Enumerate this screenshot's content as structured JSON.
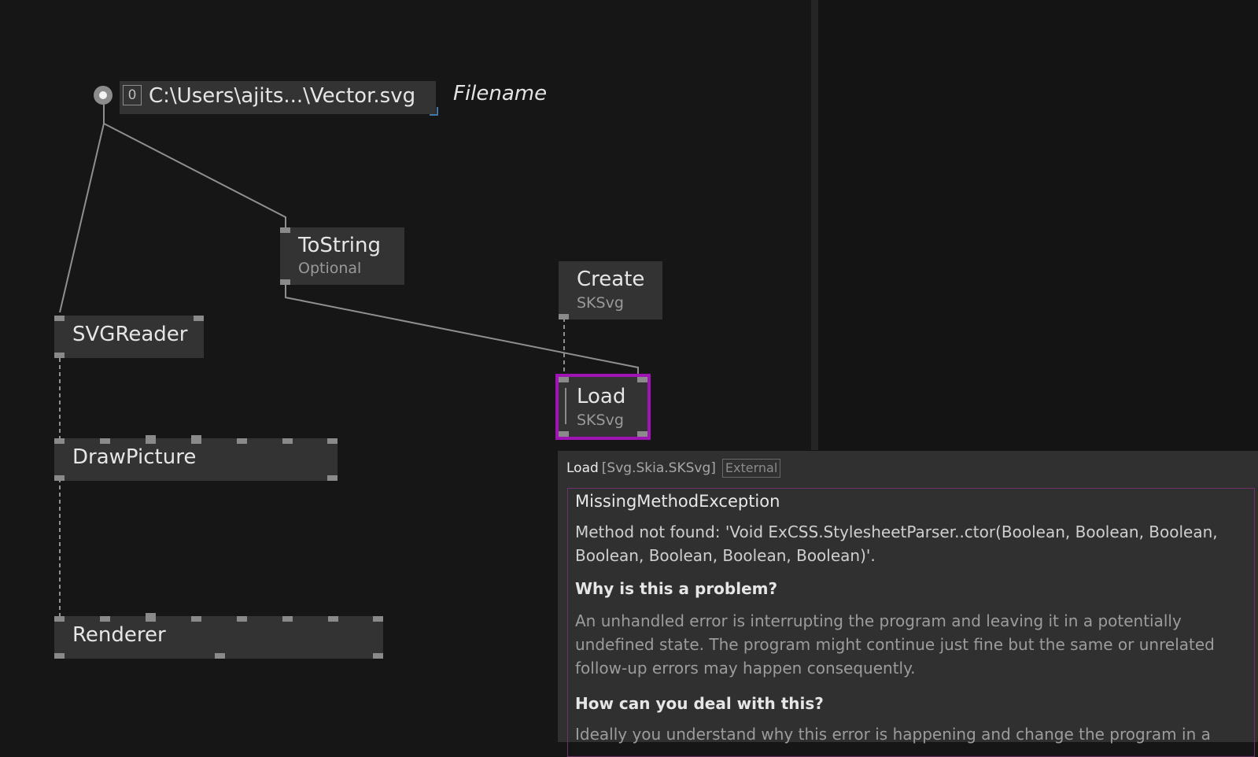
{
  "iobox": {
    "index": "0",
    "path": "C:\\Users\\ajits...\\Vector.svg",
    "comment": "Filename"
  },
  "nodes": {
    "tostring": {
      "title": "ToString",
      "subtitle": "Optional"
    },
    "create": {
      "title": "Create",
      "subtitle": "SKSvg"
    },
    "svgreader": {
      "title": "SVGReader"
    },
    "load": {
      "title": "Load",
      "subtitle": "SKSvg"
    },
    "drawpicture": {
      "title": "DrawPicture"
    },
    "renderer": {
      "title": "Renderer"
    }
  },
  "tooltip": {
    "node_name": "Load",
    "node_type": "[Svg.Skia.SKSvg]",
    "badge": "External",
    "exception": "MissingMethodException",
    "message": "Method not found: 'Void ExCSS.StylesheetParser..ctor(Boolean, Boolean, Boolean, Boolean, Boolean, Boolean, Boolean)'.",
    "why_heading": "Why is this a problem?",
    "why_text": "An unhandled error is interrupting the program and leaving it in a potentially undefined state. The program might continue just fine but the same or unrelated follow-up errors may happen consequently.",
    "how_heading": "How can you deal with this?",
    "how_text": "Ideally you understand why this error is happening and change the program in a"
  },
  "colors": {
    "background": "#161616",
    "node": "#333333",
    "selection": "#a014b6",
    "error_border": "#70306c"
  }
}
